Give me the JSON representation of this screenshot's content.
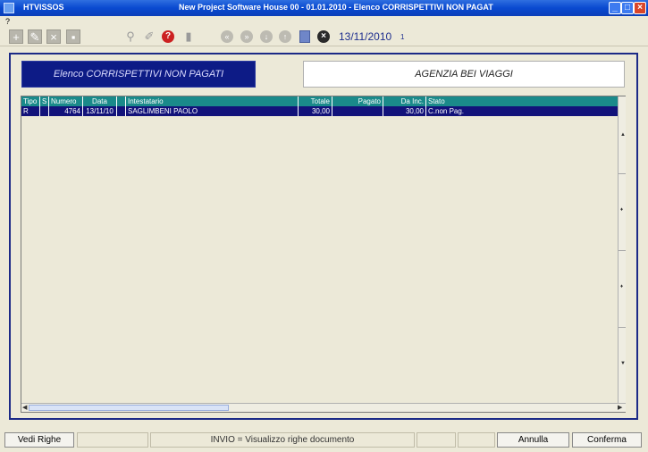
{
  "window": {
    "app_name": "HTVISSOS",
    "title": "New Project Software House   00 - 01.01.2010 - Elenco CORRISPETTIVI NON PAGAT"
  },
  "menu": {
    "help": "?"
  },
  "toolbar": {
    "date": "13/11/2010",
    "count": "1"
  },
  "header": {
    "left": "Elenco CORRISPETTIVI NON PAGATI",
    "right": "AGENZIA BEI VIAGGI"
  },
  "grid": {
    "columns": [
      "Tipo",
      "S",
      "Numero",
      "Data",
      "",
      "Intestatario",
      "Totale",
      "Pagato",
      "Da Inc.",
      "Stato"
    ],
    "rows": [
      {
        "tipo": "R",
        "s": "",
        "numero": "4764",
        "data": "13/11/10",
        "blank": "",
        "intestatario": "SAGLIMBENI PAOLO",
        "totale": "30,00",
        "pagato": "",
        "da_inc": "30,00",
        "stato": "C.non Pag."
      }
    ]
  },
  "statusbar": {
    "vedi_righe": "Vedi Righe",
    "hint": "INVIO = Visualizzo righe documento",
    "annulla": "Annulla",
    "conferma": "Conferma"
  }
}
